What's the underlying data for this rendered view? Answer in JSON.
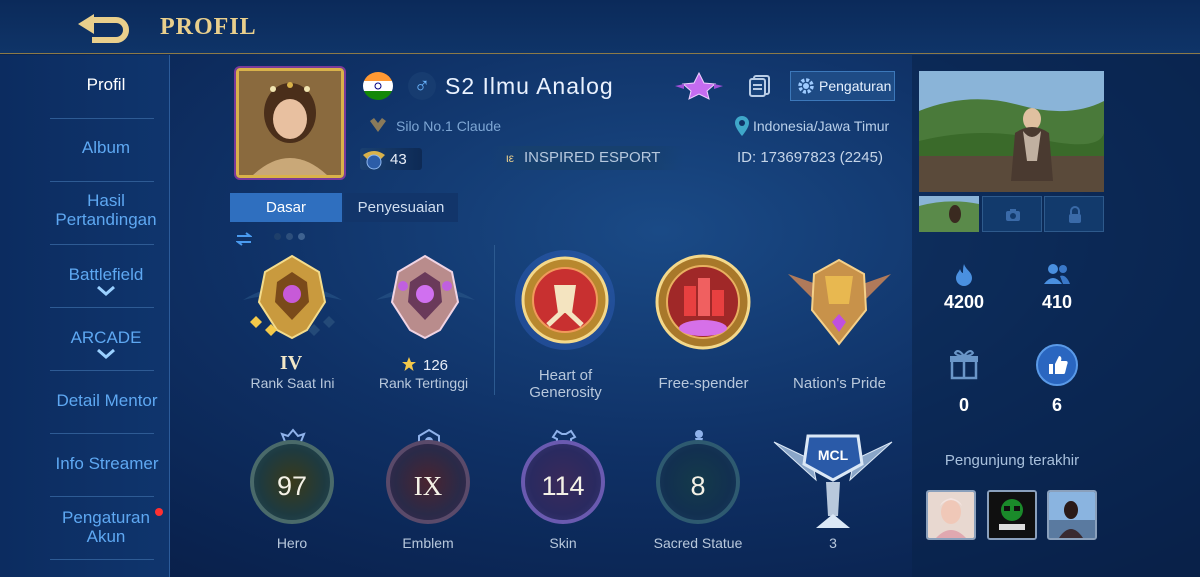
{
  "header": {
    "title": "PROFIL",
    "back_icon": "back-arrow-icon"
  },
  "sidebar": {
    "items": [
      {
        "label": "Profil"
      },
      {
        "label": "Album"
      },
      {
        "label": "Hasil\nPertandingan"
      },
      {
        "label": "Battlefield"
      },
      {
        "label": "ARCADE"
      },
      {
        "label": "Detail Mentor"
      },
      {
        "label": "Info Streamer"
      },
      {
        "label": "Pengaturan\nAkun"
      }
    ]
  },
  "profile": {
    "nickname": "S2 Ilmu Analog",
    "gender_symbol": "♂",
    "squad": "Silo No.1 Claude",
    "level": "43",
    "team": "INSPIRED ESPORT",
    "team_prefix": "ιε",
    "location": "Indonesia/Jawa Timur",
    "id_text": "ID: 173697823 (2245)",
    "settings_label": "Pengaturan"
  },
  "tabs": [
    {
      "label": "Dasar"
    },
    {
      "label": "Penyesuaian"
    }
  ],
  "badges": [
    {
      "caption": "Rank Saat Ini",
      "value": "IV"
    },
    {
      "caption": "Rank Tertinggi",
      "value": "126"
    },
    {
      "caption": "Heart of\nGenerosity"
    },
    {
      "caption": "Free-spender"
    },
    {
      "caption": "Nation's Pride"
    }
  ],
  "stats": [
    {
      "value": "97",
      "label": "Hero"
    },
    {
      "value": "IX",
      "label": "Emblem"
    },
    {
      "value": "114",
      "label": "Skin"
    },
    {
      "value": "8",
      "label": "Sacred Statue"
    },
    {
      "value": "3",
      "label": "3",
      "badge": "MCL"
    }
  ],
  "right": {
    "popularity": "4200",
    "followers": "410",
    "gifts": "0",
    "likes": "6",
    "visitors_label": "Pengunjung terakhir"
  },
  "colors": {
    "gold": "#e9cf8c",
    "accent_blue": "#5ea8f2",
    "dark_blue": "#0f3166"
  }
}
